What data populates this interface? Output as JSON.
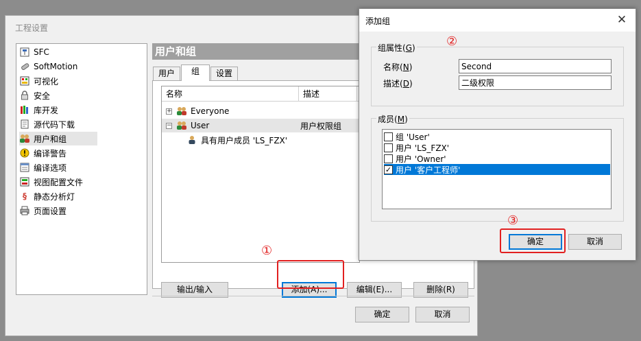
{
  "main_window": {
    "title": "工程设置",
    "tree": [
      {
        "label": "SFC",
        "icon": "sfc-icon"
      },
      {
        "label": "SoftMotion",
        "icon": "softmotion-icon"
      },
      {
        "label": "可视化",
        "icon": "visualization-icon"
      },
      {
        "label": "安全",
        "icon": "lock-icon"
      },
      {
        "label": "库开发",
        "icon": "library-icon"
      },
      {
        "label": "源代码下载",
        "icon": "source-download-icon"
      },
      {
        "label": "用户和组",
        "icon": "users-icon"
      },
      {
        "label": "编译警告",
        "icon": "warning-icon"
      },
      {
        "label": "编译选项",
        "icon": "compile-options-icon"
      },
      {
        "label": "视图配置文件",
        "icon": "view-profile-icon"
      },
      {
        "label": "静态分析灯",
        "icon": "static-analysis-icon"
      },
      {
        "label": "页面设置",
        "icon": "printer-icon"
      }
    ],
    "selected_tree_item": "用户和组",
    "section_title": "用户和组",
    "tabs": [
      "用户",
      "组",
      "设置"
    ],
    "active_tab": "组",
    "grid": {
      "columns": [
        "名称",
        "描述"
      ],
      "rows": [
        {
          "name": "Everyone",
          "description": "",
          "expander": "+"
        },
        {
          "name": "User",
          "description": "用户权限组",
          "expander": "−"
        },
        {
          "name": "具有用户成员 'LS_FZX'",
          "description": ""
        }
      ]
    },
    "buttons": {
      "export_import": "输出/输入",
      "add": "添加(A)...",
      "edit": "编辑(E)...",
      "delete": "删除(R)",
      "ok": "确定",
      "cancel": "取消"
    }
  },
  "dialog": {
    "title": "添加组",
    "close_glyph": "✕",
    "group_props": {
      "legend_text": "组属性",
      "legend_key": "G",
      "name_label": "名称",
      "name_key": "N",
      "name_value": "Second",
      "desc_label": "描述",
      "desc_key": "D",
      "desc_value": "二级权限"
    },
    "members": {
      "legend_text": "成员",
      "legend_key": "M",
      "items": [
        {
          "label": "组 'User'",
          "checked": false
        },
        {
          "label": "用户 'LS_FZX'",
          "checked": false
        },
        {
          "label": "用户 'Owner'",
          "checked": false
        },
        {
          "label": "用户 '客户工程师'",
          "checked": true
        }
      ]
    },
    "ok": "确定",
    "cancel": "取消"
  },
  "annotations": {
    "marker_1": "①",
    "marker_2": "②",
    "marker_3": "③",
    "color": "#e21f1f"
  },
  "colors": {
    "selection_blue": "#0078d7",
    "header_gray": "#a0a0a0"
  }
}
